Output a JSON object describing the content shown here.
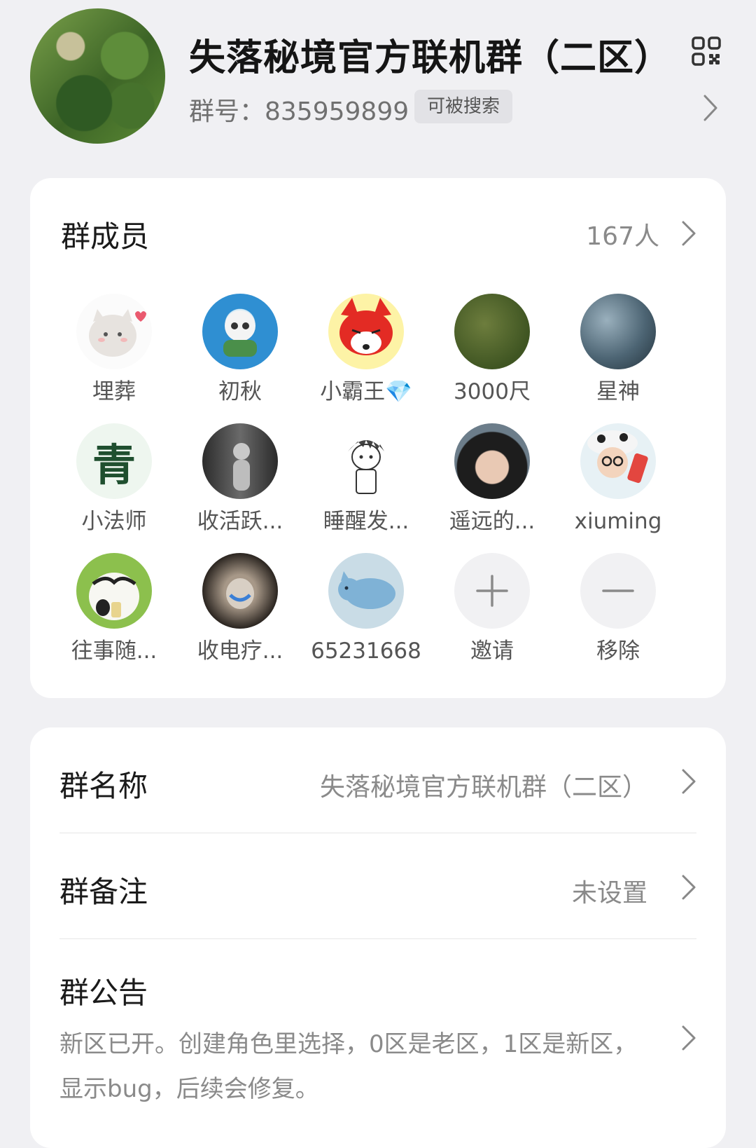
{
  "header": {
    "title": "失落秘境官方联机群（二区）",
    "group_id": "群号：835959899",
    "search_badge": "可被搜索"
  },
  "members": {
    "section_title": "群成员",
    "count": "167人",
    "list": [
      {
        "name": "埋葬",
        "avatar": "cat-sticker"
      },
      {
        "name": "初秋",
        "avatar": "cartoon-panda"
      },
      {
        "name": "小霸王💎",
        "avatar": "red-fox-cartoon"
      },
      {
        "name": "3000尺",
        "avatar": "game-scene"
      },
      {
        "name": "星神",
        "avatar": "blue-nebula"
      },
      {
        "name": "小法师",
        "avatar": "calligraphy-qing"
      },
      {
        "name": "收活跃...",
        "avatar": "dark-alley-figure"
      },
      {
        "name": "睡醒发...",
        "avatar": "sketch-boy"
      },
      {
        "name": "遥远的...",
        "avatar": "child-photo"
      },
      {
        "name": "xiuming",
        "avatar": "girl-with-cup"
      },
      {
        "name": "往事随...",
        "avatar": "cow-cartoon"
      },
      {
        "name": "收电疗...",
        "avatar": "glowing-rabbit"
      },
      {
        "name": "65231668",
        "avatar": "blue-cat-drawing"
      }
    ],
    "invite_label": "邀请",
    "remove_label": "移除"
  },
  "info": {
    "name_label": "群名称",
    "name_value": "失落秘境官方联机群（二区）",
    "remark_label": "群备注",
    "remark_value": "未设置",
    "notice_label": "群公告",
    "notice_text": "新区已开。创建角色里选择，0区是老区，1区是新区，显示bug，后续会修复。"
  },
  "colors": {
    "background": "#f0f0f3",
    "card": "#ffffff",
    "secondary_text": "#8a8a8a"
  }
}
